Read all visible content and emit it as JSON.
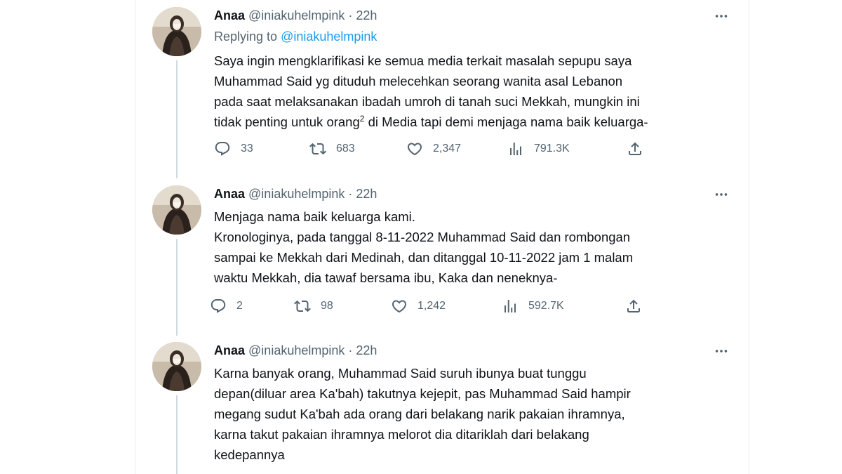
{
  "tweets": [
    {
      "name": "Anaa",
      "handle": "@iniakuhelmpink",
      "dot": "·",
      "time": "22h",
      "replying_prefix": "Replying to",
      "replying_to": "@iniakuhelmpink",
      "lines": [
        "Saya ingin mengklarifikasi ke semua media terkait masalah sepupu saya",
        "Muhammad Said yg dituduh melecehkan seorang wanita asal Lebanon",
        "pada saat melaksanakan ibadah umroh di tanah suci Mekkah, mungkin ini"
      ],
      "last_line_before": "tidak penting untuk orang",
      "last_line_sup": "2",
      "last_line_after": " di Media tapi demi menjaga nama baik keluarga-",
      "replies": "33",
      "retweets": "683",
      "likes": "2,347",
      "views": "791.3K"
    },
    {
      "name": "Anaa",
      "handle": "@iniakuhelmpink",
      "dot": "·",
      "time": "22h",
      "lines": [
        "Menjaga nama baik keluarga kami.",
        "Kronologinya, pada tanggal 8-11-2022 Muhammad Said dan rombongan",
        "sampai ke Mekkah dari Medinah, dan ditanggal 10-11-2022 jam 1 malam",
        "waktu Mekkah, dia tawaf bersama ibu, Kaka dan neneknya-"
      ],
      "replies": "2",
      "retweets": "98",
      "likes": "1,242",
      "views": "592.7K"
    },
    {
      "name": "Anaa",
      "handle": "@iniakuhelmpink",
      "dot": "·",
      "time": "22h",
      "lines": [
        "Karna banyak orang, Muhammad Said suruh ibunya buat tunggu",
        "depan(diluar area Ka'bah) takutnya kejepit, pas Muhammad Said hampir",
        "megang sudut Ka'bah ada orang dari belakang narik pakaian ihramnya,",
        "karna takut pakaian ihramnya melorot dia ditariklah dari belakang",
        "kedepannya"
      ]
    }
  ],
  "icons": {
    "reply": "reply-icon",
    "retweet": "retweet-icon",
    "like": "heart-icon",
    "views": "analytics-icon",
    "share": "share-icon",
    "more": "more-icon"
  }
}
